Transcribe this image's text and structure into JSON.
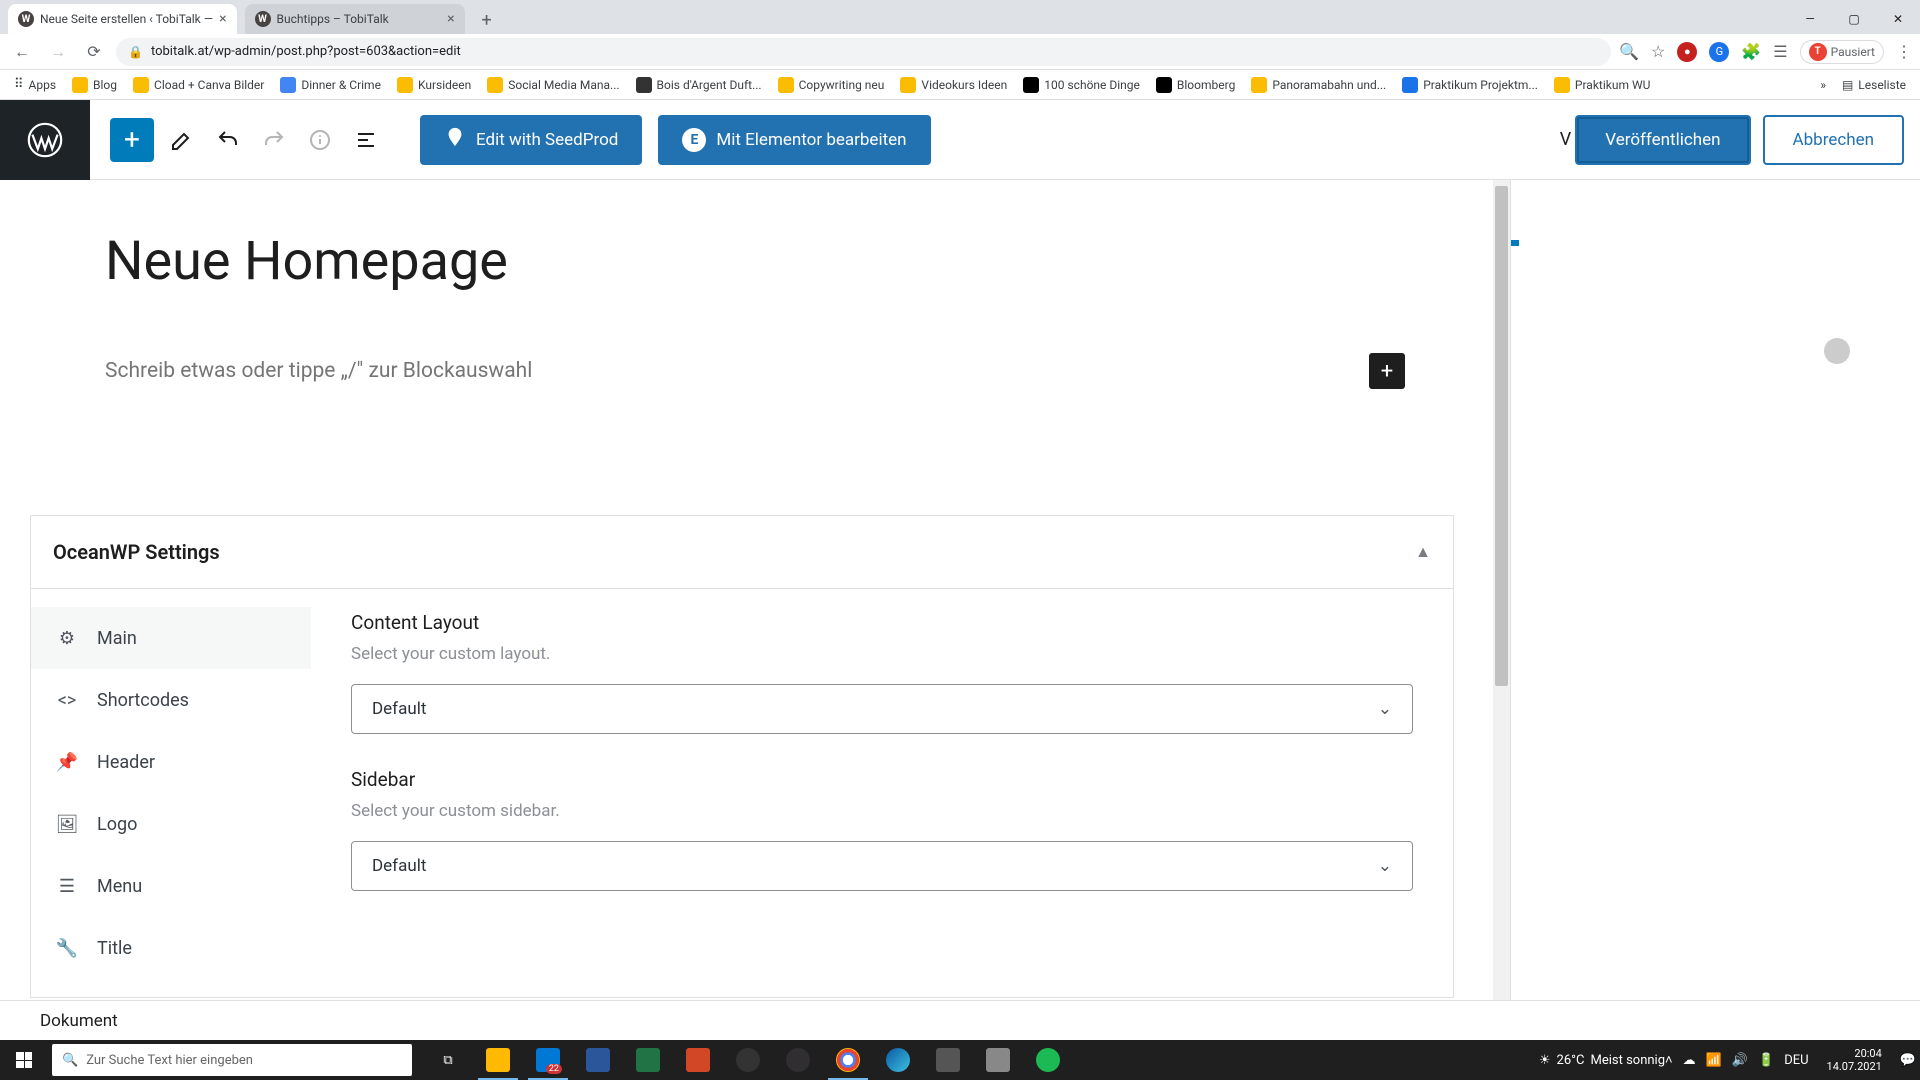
{
  "browser": {
    "tabs": [
      {
        "title": "Neue Seite erstellen ‹ TobiTalk —",
        "active": true
      },
      {
        "title": "Buchtipps – TobiTalk",
        "active": false
      }
    ],
    "url": "tobitalk.at/wp-admin/post.php?post=603&action=edit",
    "pausiert": "Pausiert",
    "bookmarks": [
      "Apps",
      "Blog",
      "Cload + Canva Bilder",
      "Dinner & Crime",
      "Kursideen",
      "Social Media Mana...",
      "Bois d'Argent Duft...",
      "Copywriting neu",
      "Videokurs Ideen",
      "100 schöne Dinge",
      "Bloomberg",
      "Panoramabahn und...",
      "Praktikum Projektm...",
      "Praktikum WU"
    ],
    "bookmark_overflow": "»",
    "leseliste": "Leseliste"
  },
  "editor": {
    "seedprod_label": "Edit with SeedProd",
    "elementor_label": "Mit Elementor bearbeiten",
    "publish_label": "Veröffentlichen",
    "cancel_label": "Abbrechen",
    "page_title": "Neue Homepage",
    "block_placeholder": "Schreib etwas oder tippe „/\" zur Blockauswahl",
    "partial_char": "V"
  },
  "oceanwp": {
    "panel_title": "OceanWP Settings",
    "tabs": [
      "Main",
      "Shortcodes",
      "Header",
      "Logo",
      "Menu",
      "Title"
    ],
    "content_layout": {
      "label": "Content Layout",
      "desc": "Select your custom layout.",
      "value": "Default"
    },
    "sidebar": {
      "label": "Sidebar",
      "desc": "Select your custom sidebar.",
      "value": "Default"
    }
  },
  "footer": {
    "breadcrumb": "Dokument"
  },
  "taskbar": {
    "search_placeholder": "Zur Suche Text hier eingeben",
    "weather_temp": "26°C",
    "weather_desc": "Meist sonnig",
    "lang": "DEU",
    "time": "20:04",
    "date": "14.07.2021",
    "explorer_badge": "22"
  }
}
